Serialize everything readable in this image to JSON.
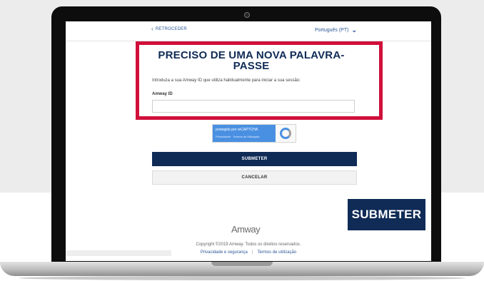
{
  "header": {
    "back_label": "RETROCEDER",
    "language": "Português (PT)"
  },
  "form": {
    "title": "PRECISO DE UMA NOVA PALAVRA-PASSE",
    "intro": "Introduza a sua Amway ID que utiliza habitualmente para iniciar a sua sessão:",
    "field_label": "Amway ID",
    "field_value": ""
  },
  "recaptcha": {
    "label": "protegido por reCAPTCHA",
    "links": "Privacidade · Termos de Utilização"
  },
  "buttons": {
    "submit": "SUBMETER",
    "cancel": "CANCELAR"
  },
  "footer": {
    "logo": "Amway",
    "copyright": "Copyright ©2019 Amway. Todos os direitos reservados.",
    "privacy": "Privacidade e segurança",
    "separator": "|",
    "terms": "Termos de utilização"
  },
  "callout": {
    "label": "SUBMETER"
  },
  "colors": {
    "highlight": "#d0103a",
    "primary": "#0f2b56",
    "link": "#2b5797"
  }
}
